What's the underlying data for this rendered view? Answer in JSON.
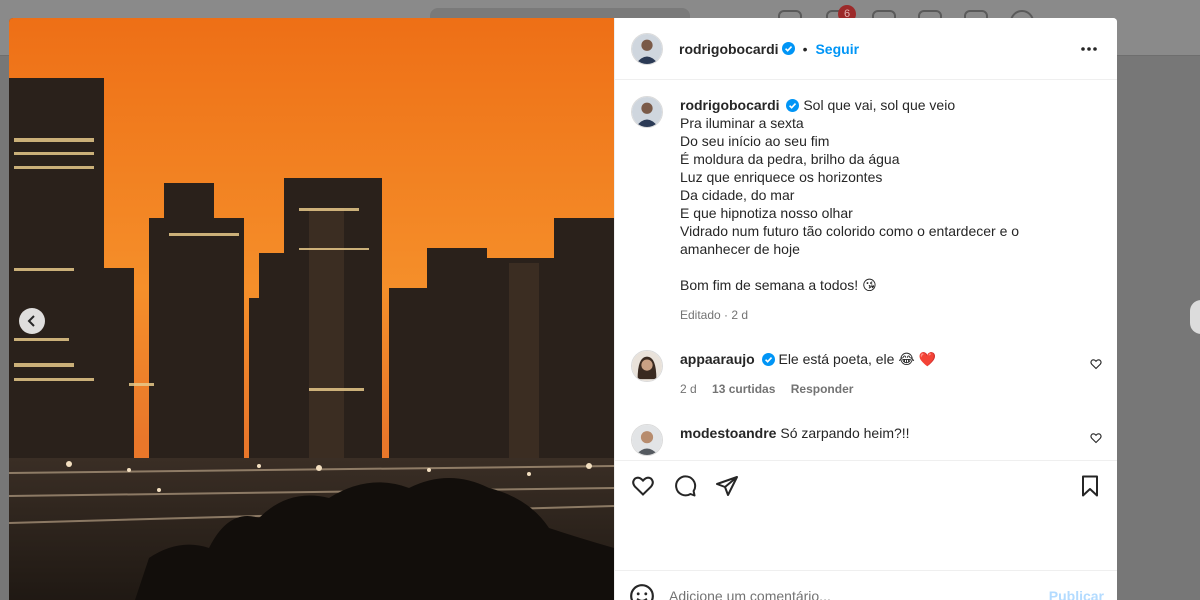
{
  "background": {
    "notification_count": "6"
  },
  "post": {
    "author": {
      "username": "rodrigobocardi",
      "verified": true,
      "follow_label": "Seguir",
      "separator": "•"
    },
    "caption": {
      "lines": [
        "Sol que vai, sol que veio",
        "Pra iluminar a sexta",
        "Do seu início ao seu fim",
        "É moldura da pedra, brilho da água",
        "Luz que enriquece os horizontes",
        "Da cidade, do mar",
        "E que hipnotiza nosso olhar",
        "Vidrado num futuro tão colorido como o entardecer e o",
        "amanhecer de hoje",
        "",
        "Bom fim de semana a todos! 😘"
      ],
      "meta": "Editado · 2 d"
    },
    "comments": [
      {
        "username": "appaaraujo",
        "verified": true,
        "text": "Ele está poeta, ele 😂 ❤️",
        "time": "2 d",
        "likes": "13 curtidas",
        "reply_label": "Responder"
      },
      {
        "username": "modestoandre",
        "verified": false,
        "text": "Só zarpando heim?!!"
      }
    ],
    "actions": {
      "icons": [
        "heart-icon",
        "comment-icon",
        "share-icon",
        "bookmark-icon"
      ]
    },
    "comment_box": {
      "placeholder": "Adicione um comentário...",
      "publish_label": "Publicar"
    }
  },
  "colors": {
    "accent": "#0095f6",
    "verified": "#0095f6",
    "sky_top": "#f27a1a",
    "sky_bottom": "#f6a23a"
  }
}
